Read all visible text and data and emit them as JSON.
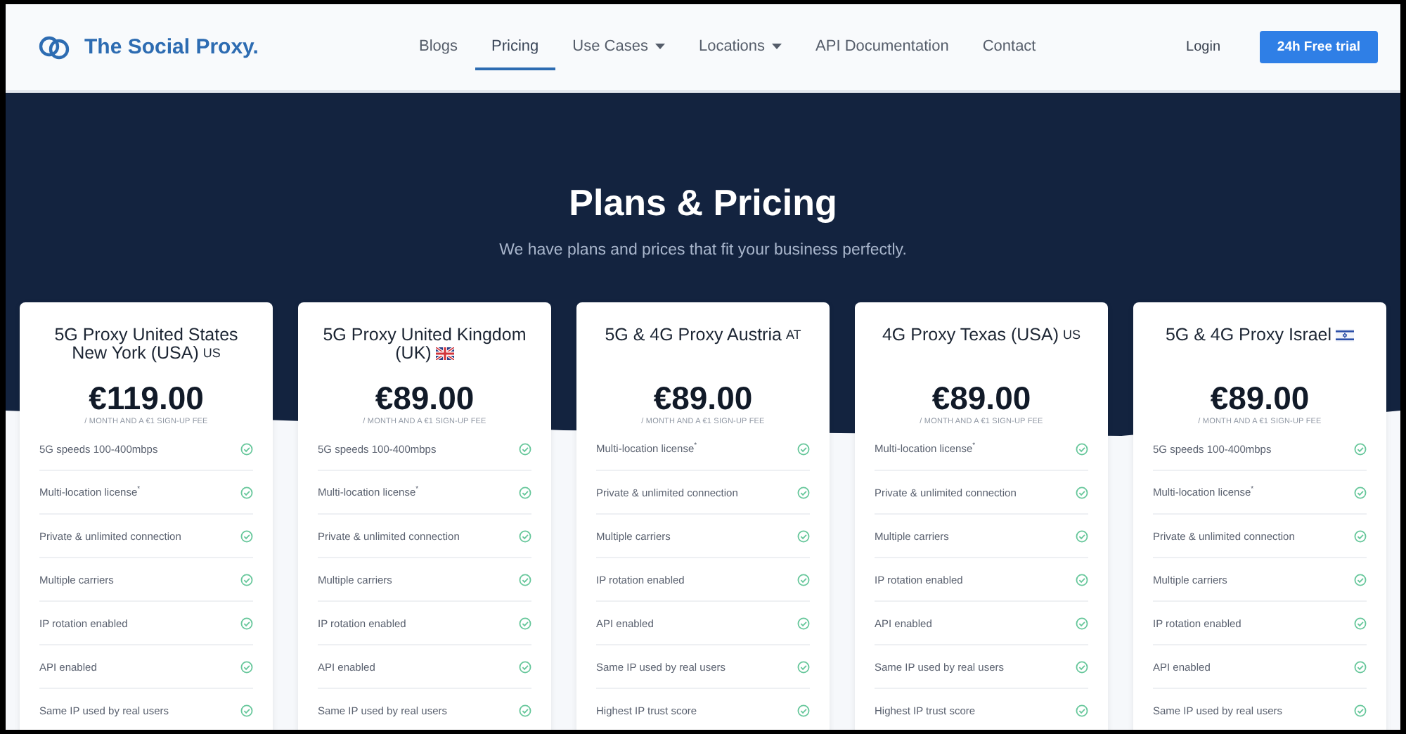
{
  "header": {
    "brand": "The Social Proxy.",
    "nav": [
      {
        "label": "Blogs",
        "selected": false,
        "dropdown": false
      },
      {
        "label": "Pricing",
        "selected": true,
        "dropdown": false
      },
      {
        "label": "Use Cases",
        "selected": false,
        "dropdown": true
      },
      {
        "label": "Locations",
        "selected": false,
        "dropdown": true
      },
      {
        "label": "API Documentation",
        "selected": false,
        "dropdown": false
      },
      {
        "label": "Contact",
        "selected": false,
        "dropdown": false
      }
    ],
    "login": "Login",
    "cta": "24h Free trial"
  },
  "hero": {
    "title": "Plans & Pricing",
    "subtitle": "We have plans and prices that fit your business perfectly."
  },
  "plans": [
    {
      "title": [
        "5G Proxy United States",
        "New York (USA)"
      ],
      "badge": {
        "kind": "code",
        "text": "US"
      },
      "price": "€119.00",
      "note": "/ MONTH AND A €1 SIGN-UP FEE",
      "features": [
        {
          "label": "5G speeds 100-400mbps",
          "included": true
        },
        {
          "label": "Multi-location license$^{*}$",
          "included": true
        },
        {
          "label": "Private & unlimited connection",
          "included": true
        },
        {
          "label": "Multiple carriers",
          "included": true
        },
        {
          "label": "IP rotation enabled",
          "included": true
        },
        {
          "label": "API enabled",
          "included": true
        },
        {
          "label": "Same IP used by real users",
          "included": true
        }
      ]
    },
    {
      "title": [
        "5G Proxy United Kingdom",
        "(UK)"
      ],
      "badge": {
        "kind": "uk-flag"
      },
      "price": "€89.00",
      "note": "/ MONTH AND A €1 SIGN-UP FEE",
      "features": [
        {
          "label": "5G speeds 100-400mbps",
          "included": true
        },
        {
          "label": "Multi-location license$^{*}$",
          "included": true
        },
        {
          "label": "Private & unlimited connection",
          "included": true
        },
        {
          "label": "Multiple carriers",
          "included": true
        },
        {
          "label": "IP rotation enabled",
          "included": true
        },
        {
          "label": "API enabled",
          "included": true
        },
        {
          "label": "Same IP used by real users",
          "included": true
        }
      ]
    },
    {
      "title": [
        "5G & 4G Proxy Austria"
      ],
      "badge": {
        "kind": "code",
        "text": "AT"
      },
      "price": "€89.00",
      "note": "/ MONTH AND A €1 SIGN-UP FEE",
      "features": [
        {
          "label": "Multi-location license$^{*}$",
          "included": true
        },
        {
          "label": "Private & unlimited connection",
          "included": true
        },
        {
          "label": "Multiple carriers",
          "included": true
        },
        {
          "label": "IP rotation enabled",
          "included": true
        },
        {
          "label": "API enabled",
          "included": true
        },
        {
          "label": "Same IP used by real users",
          "included": true
        },
        {
          "label": "Highest IP trust score",
          "included": true
        }
      ]
    },
    {
      "title": [
        "4G Proxy Texas (USA)"
      ],
      "badge": {
        "kind": "code",
        "text": "US"
      },
      "price": "€89.00",
      "note": "/ MONTH AND A €1 SIGN-UP FEE",
      "features": [
        {
          "label": "Multi-location license$^{*}$",
          "included": true
        },
        {
          "label": "Private & unlimited connection",
          "included": true
        },
        {
          "label": "Multiple carriers",
          "included": true
        },
        {
          "label": "IP rotation enabled",
          "included": true
        },
        {
          "label": "API enabled",
          "included": true
        },
        {
          "label": "Same IP used by real users",
          "included": true
        },
        {
          "label": "Highest IP trust score",
          "included": true
        }
      ]
    },
    {
      "title": [
        "5G & 4G Proxy Israel"
      ],
      "badge": {
        "kind": "israel-flag"
      },
      "price": "€89.00",
      "note": "/ MONTH AND A €1 SIGN-UP FEE",
      "features": [
        {
          "label": "5G speeds 100-400mbps",
          "included": true
        },
        {
          "label": "Multi-location license$^{*}$",
          "included": true
        },
        {
          "label": "Private & unlimited connection",
          "included": true
        },
        {
          "label": "Multiple carriers",
          "included": true
        },
        {
          "label": "IP rotation enabled",
          "included": true
        },
        {
          "label": "API enabled",
          "included": true
        },
        {
          "label": "Same IP used by real users",
          "included": true
        }
      ]
    }
  ]
}
